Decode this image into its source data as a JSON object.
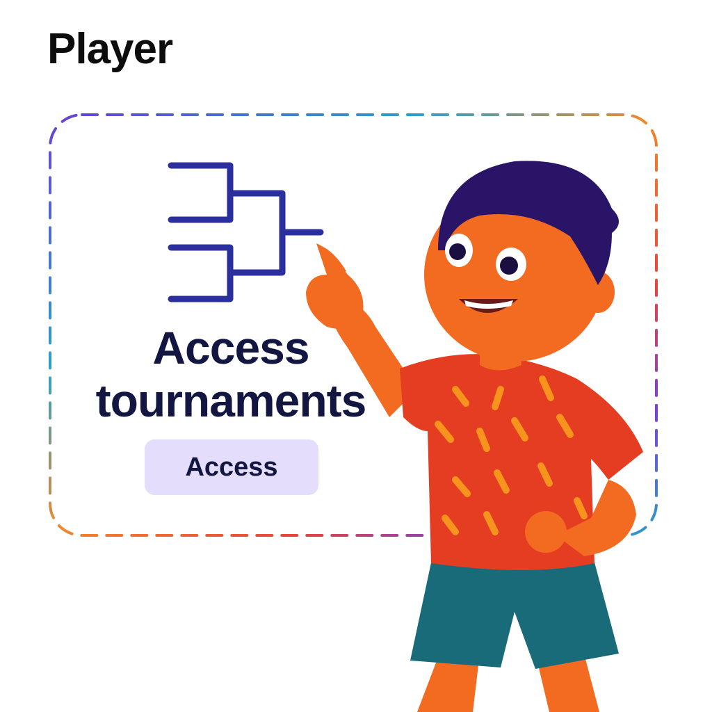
{
  "header": {
    "title": "Player"
  },
  "card": {
    "headline_line1": "Access",
    "headline_line2": "tournaments",
    "button_label": "Access",
    "icon": "tournament-bracket-icon"
  },
  "illustration": {
    "subject": "boy-pointing-illustration"
  },
  "colors": {
    "bracket": "#2b2f9e",
    "headline": "#121640",
    "button_bg": "#e4ddfb",
    "skin": "#f26b21",
    "shirt": "#e43d22",
    "shorts": "#1a6b7a",
    "hair": "#2a1468"
  }
}
